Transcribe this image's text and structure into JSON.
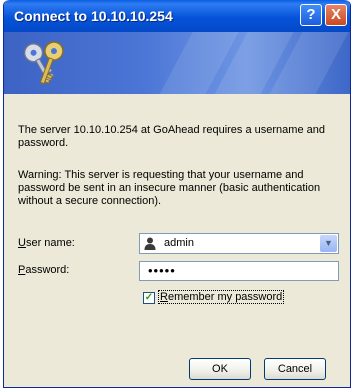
{
  "dialog": {
    "title": "Connect to 10.10.10.254",
    "help_glyph": "?",
    "close_glyph": "X",
    "banner_icon": "keys-icon",
    "message_line1": "The server 10.10.10.254 at GoAhead requires a username and password.",
    "message_warning": "Warning: This server is requesting that your username and password be sent in an insecure manner (basic authentication without a secure connection).",
    "username": {
      "label_first": "U",
      "label_rest": "ser name:",
      "value": "admin",
      "icon": "user-icon"
    },
    "password": {
      "label_first": "P",
      "label_rest": "assword:",
      "value": "•••••"
    },
    "remember": {
      "checked": true,
      "label_first": "R",
      "label_rest": "emember my password"
    },
    "buttons": {
      "ok": "OK",
      "cancel": "Cancel"
    },
    "colors": {
      "titlebar": "#0553d9",
      "banner": "#4b76d6",
      "dialog_bg": "#ece9d8"
    }
  }
}
